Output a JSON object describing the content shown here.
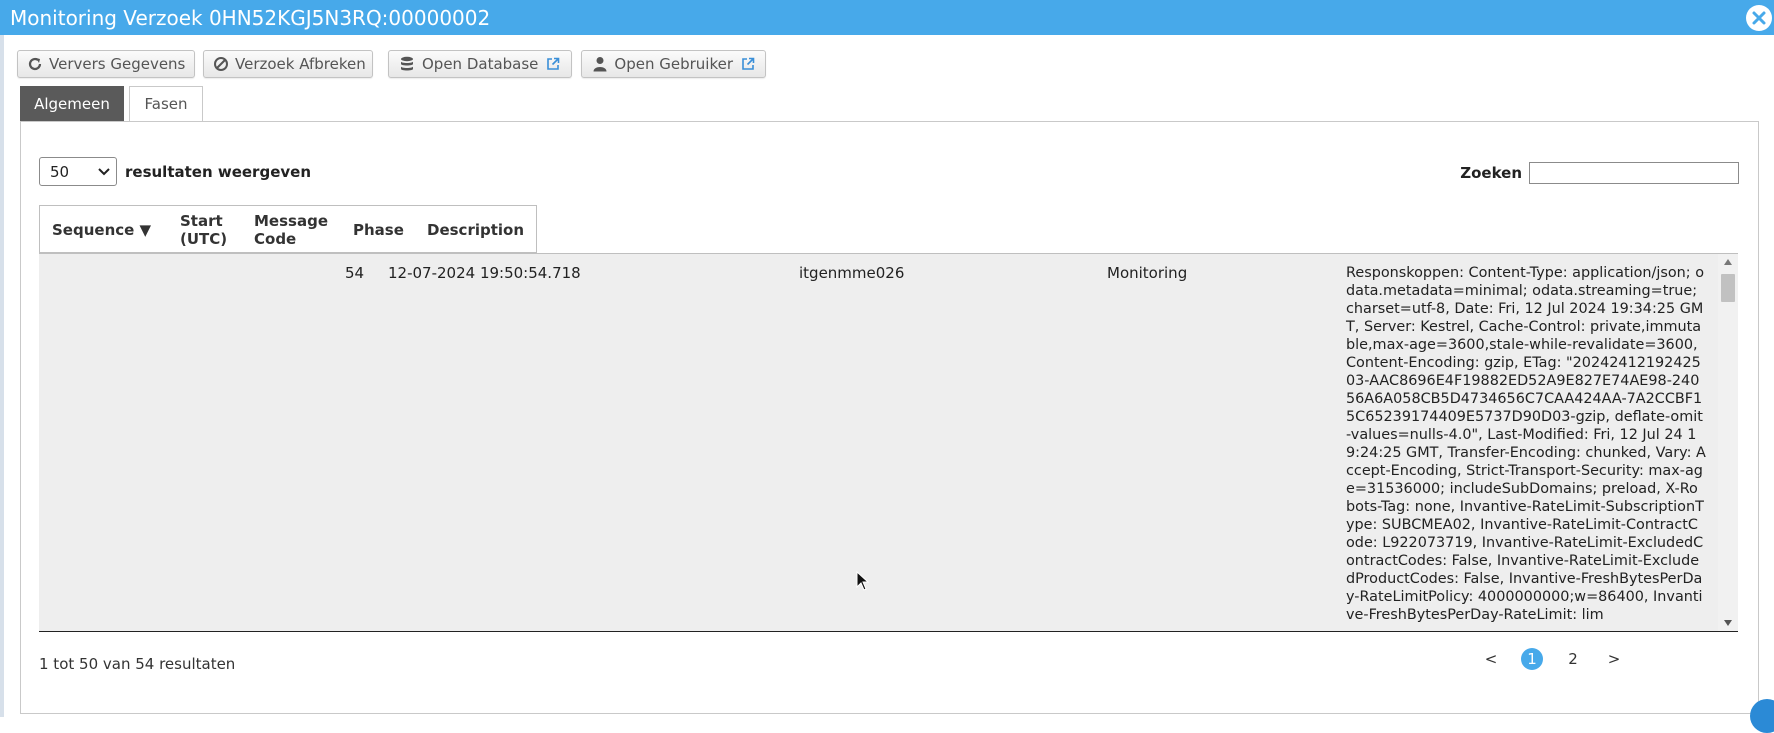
{
  "window": {
    "title": "Monitoring Verzoek 0HN52KGJ5N3RQ:00000002",
    "accent_color": "#47a9ea"
  },
  "toolbar": {
    "refresh_label": "Ververs Gegevens",
    "abort_label": "Verzoek Afbreken",
    "open_db_label": "Open Database",
    "open_user_label": "Open Gebruiker"
  },
  "tabs": [
    {
      "label": "Algemeen"
    },
    {
      "label": "Fasen"
    }
  ],
  "table_controls": {
    "length_value": "50",
    "length_label": "resultaten weergeven",
    "search_label": "Zoeken",
    "search_value": ""
  },
  "columns": [
    {
      "label": "Sequence ▼"
    },
    {
      "label": "Start\n(UTC)"
    },
    {
      "label": "Message\nCode"
    },
    {
      "label": "Phase"
    },
    {
      "label": "Description"
    }
  ],
  "row": {
    "sequence": "54",
    "start": "12-07-2024 19:50:54.718",
    "message_code": "itgenmme026",
    "phase": "Monitoring",
    "description": "Responskoppen: Content-Type: application/json; odata.metadata=minimal; odata.streaming=true; charset=utf-8, Date: Fri, 12 Jul 2024 19:34:25 GMT, Server: Kestrel, Cache-Control: private,immutable,max-age=3600,stale-while-revalidate=3600, Content-Encoding: gzip, ETag: \"2024241219242503-AAC8696E4F19882ED52A9E827E74AE98-24056A6A058CB5D4734656C7CAA424AA-7A2CCBF15C65239174409E5737D90D03-gzip, deflate-omit-values=nulls-4.0\", Last-Modified: Fri, 12 Jul 24 19:24:25 GMT, Transfer-Encoding: chunked, Vary: Accept-Encoding, Strict-Transport-Security: max-age=31536000; includeSubDomains; preload, X-Robots-Tag: none, Invantive-RateLimit-SubscriptionType: SUBCMEA02, Invantive-RateLimit-ContractCode: L922073719, Invantive-RateLimit-ExcludedContractCodes: False, Invantive-RateLimit-ExcludedProductCodes: False, Invantive-FreshBytesPerDay-RateLimitPolicy: 4000000000;w=86400, Invantive-FreshBytesPerDay-RateLimit: lim"
  },
  "footer": {
    "info": "1 tot 50 van 54 resultaten",
    "prev": "<",
    "pages": [
      "1",
      "2"
    ],
    "next": ">"
  }
}
